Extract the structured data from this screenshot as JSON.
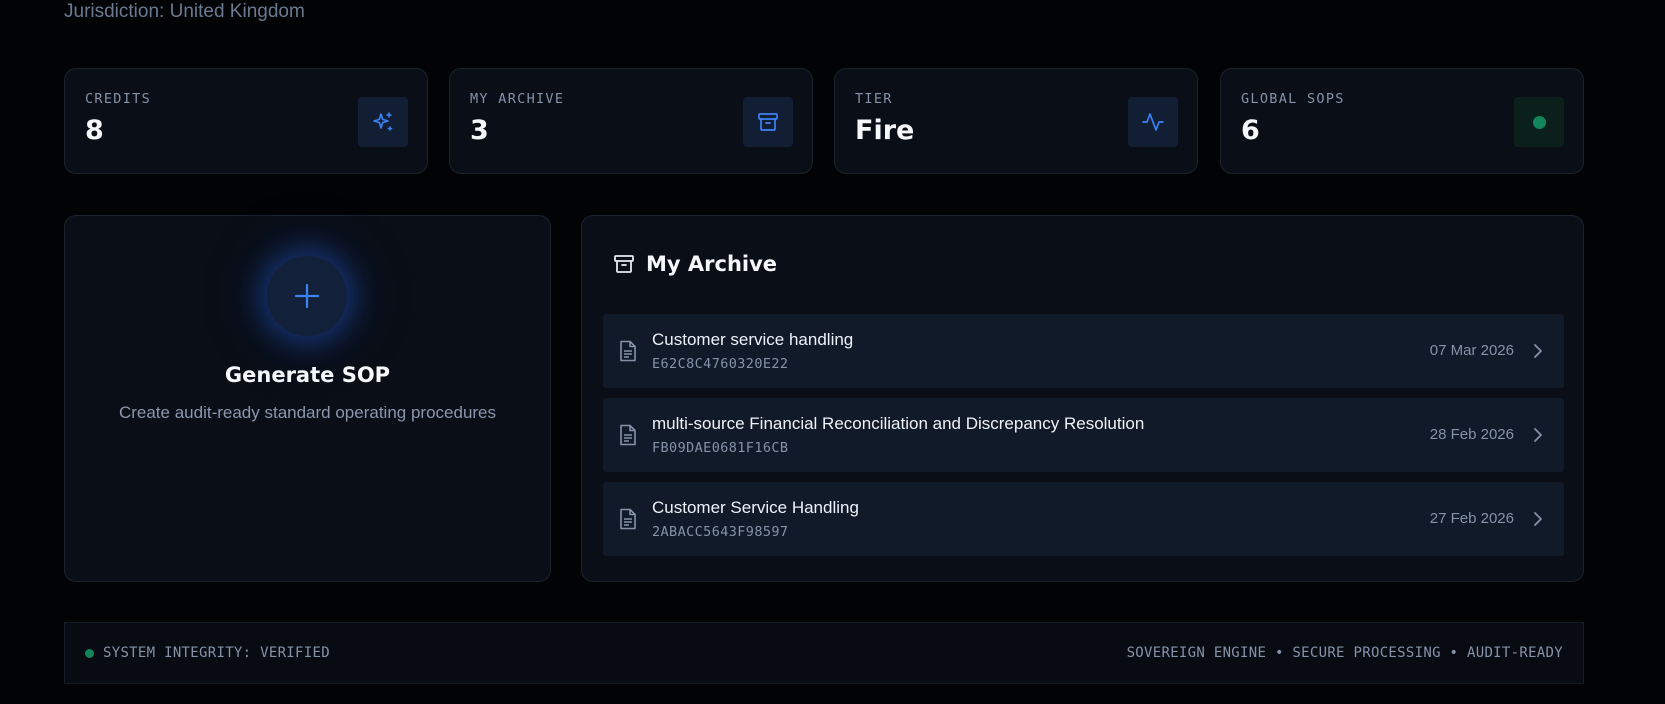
{
  "header": {
    "jurisdiction": "Jurisdiction: United Kingdom"
  },
  "stats": [
    {
      "label": "CREDITS",
      "value": "8",
      "icon": "sparkles-icon"
    },
    {
      "label": "MY ARCHIVE",
      "value": "3",
      "icon": "archive-box-icon"
    },
    {
      "label": "TIER",
      "value": "Fire",
      "icon": "activity-pulse-icon"
    },
    {
      "label": "GLOBAL SOPS",
      "value": "6",
      "icon": "status-dot-icon"
    }
  ],
  "generate": {
    "title": "Generate SOP",
    "subtitle": "Create audit-ready standard operating procedures",
    "icon": "plus-icon"
  },
  "archive": {
    "title": "My Archive",
    "icon": "archive-box-icon",
    "items": [
      {
        "name": "Customer service handling",
        "code": "E62C8C4760320E22",
        "date": "07 Mar 2026"
      },
      {
        "name": "multi-source Financial Reconciliation and Discrepancy Resolution",
        "code": "FB09DAE0681F16CB",
        "date": "28 Feb 2026"
      },
      {
        "name": "Customer Service Handling",
        "code": "2ABACC5643F98597",
        "date": "27 Feb 2026"
      }
    ]
  },
  "footer": {
    "status": "SYSTEM INTEGRITY: VERIFIED",
    "tagline": "SOVEREIGN ENGINE • SECURE PROCESSING • AUDIT-READY"
  },
  "colors": {
    "accent": "#3b82f6",
    "success": "#12855b",
    "background": "#020305",
    "card": "#0a0e16"
  }
}
